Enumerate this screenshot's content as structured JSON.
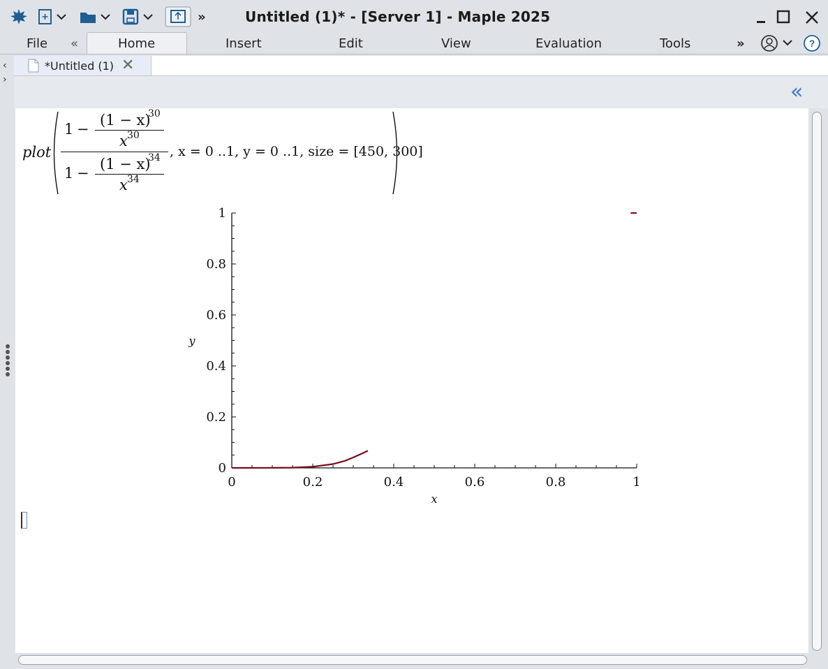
{
  "window": {
    "title": "Untitled (1)* - [Server 1] - Maple 2025"
  },
  "menu": {
    "file": "File",
    "home": "Home",
    "insert": "Insert",
    "edit": "Edit",
    "view": "View",
    "evaluation": "Evaluation",
    "tools": "Tools"
  },
  "tab": {
    "label": "*Untitled (1)"
  },
  "command": {
    "func": "plot",
    "one": "1",
    "minus": "−",
    "base": "(1 − x)",
    "x": "x",
    "exp_top": "30",
    "exp_bottom": "34",
    "tail": ", x = 0 ..1, y = 0 ..1, size = [450, 300]"
  },
  "chart_data": {
    "type": "line",
    "xlabel": "x",
    "ylabel": "y",
    "xlim": [
      0,
      1
    ],
    "ylim": [
      0,
      1
    ],
    "xticks": [
      "0",
      "0.2",
      "0.4",
      "0.6",
      "0.8",
      "1"
    ],
    "yticks": [
      "0",
      "0.2",
      "0.4",
      "0.6",
      "0.8",
      "1"
    ],
    "series": [
      {
        "color": "#7a0d1e",
        "x": [
          0.0,
          0.05,
          0.1,
          0.15,
          0.2,
          0.25,
          0.28,
          0.3,
          0.32,
          0.336
        ],
        "y": [
          0.0,
          0.0,
          0.0003,
          0.0012,
          0.0045,
          0.015,
          0.028,
          0.041,
          0.055,
          0.067
        ]
      },
      {
        "color": "#7a0d1e",
        "x": [
          0.985,
          1.0
        ],
        "y": [
          1.0,
          1.0
        ]
      }
    ]
  }
}
